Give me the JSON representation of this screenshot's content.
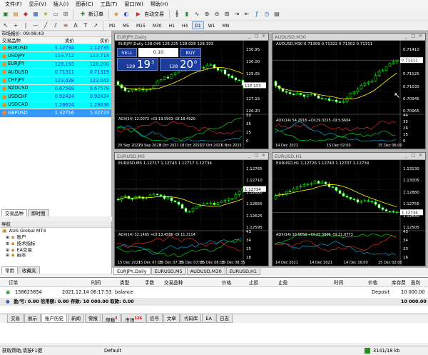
{
  "menu": [
    "文件(F)",
    "显示(V)",
    "插入(I)",
    "图表(C)",
    "工具(T)",
    "窗口(W)",
    "帮助(H)"
  ],
  "toolbar": {
    "new_order": "新订单",
    "auto_trading": "自动交易",
    "timeframes": [
      "M1",
      "M5",
      "M15",
      "M30",
      "H1",
      "H4",
      "D1",
      "W1",
      "MN"
    ],
    "active_timeframe": "D1"
  },
  "market_watch": {
    "title": "市场报价: 09:08:43",
    "headers": {
      "symbol": "交易品种",
      "bid": "卖价",
      "ask": "买价"
    },
    "rows": [
      {
        "symbol": "EURUSD",
        "bid": "1.12734",
        "ask": "1.12735"
      },
      {
        "symbol": "USDJPY",
        "bid": "113.712",
        "ask": "113.714"
      },
      {
        "symbol": "EURJPY",
        "bid": "128.193",
        "ask": "128.200"
      },
      {
        "symbol": "AUDUSD",
        "bid": "0.71311",
        "ask": "0.71319"
      },
      {
        "symbol": "CHFJPY",
        "bid": "123.028",
        "ask": "123.042"
      },
      {
        "symbol": "NZDUSD",
        "bid": "0.67569",
        "ask": "0.67578"
      },
      {
        "symbol": "USDCHF",
        "bid": "0.92424",
        "ask": "0.92434"
      },
      {
        "symbol": "USDCAD",
        "bid": "1.28624",
        "ask": "1.28636"
      },
      {
        "symbol": "GBPUSD",
        "bid": "1.32716",
        "ask": "1.32723"
      }
    ],
    "tabs": [
      "交易品种",
      "即时图"
    ]
  },
  "navigator": {
    "title": "导航",
    "items": [
      "AUS Global MT4",
      "账户",
      "技术指标",
      "EA交易",
      "脚本"
    ],
    "tabs": [
      "常用",
      "收藏夹"
    ]
  },
  "charts": [
    {
      "title": "EURJPY,Daily",
      "info": "EURJPY,Daily  128.046 128.225 128.028 128.193",
      "indicator": "ADX(14) 22.0072 +DI:19.5903 -DI:18.4920",
      "sell_label": "SELL",
      "buy_label": "BUY",
      "lot": "0.10",
      "sell_small": "128",
      "sell_big": "19",
      "sell_sup": "3",
      "buy_small": "128",
      "buy_big": "20",
      "buy_sup": "0",
      "price_tag": "128.193",
      "y_labels": [
        "130.95",
        "130.00",
        "129.05",
        "128.10",
        "127.15",
        "126.20",
        "50",
        "35",
        "25",
        "0"
      ],
      "x_labels": [
        "20 Sep 2021",
        "29 Sep 2021",
        "8 Oct 2021",
        "18 Oct 2021",
        "27 Oct 2021",
        "5 Nov 2021"
      ]
    },
    {
      "title": "AUDUSD,M30",
      "info": "AUDUSD,M30  0.71309 0.71322 0.71302 0.71311",
      "indicator": "ADX(14) 54.2918 +DI:29.3225 -DI:5.6604",
      "price_tag": "0.71311",
      "y_labels": [
        "0.71410",
        "0.71220",
        "0.71125",
        "0.71030",
        "0.70945",
        "0.70965",
        "44",
        "35",
        "26",
        "15",
        "0"
      ],
      "x_labels": [
        "14 Dec 2021",
        "15 Dec 02:00",
        "15 Dec 06:00"
      ]
    },
    {
      "title": "EURUSD,M5",
      "info": "EURUSD,M5  1.12717 1.12743 1.12717 1.12734",
      "indicator": "ADX(14) 32.1485 +DI:13.4586 -DI:11.3114",
      "price_tag": "1.12734",
      "y_labels": [
        "1.12765",
        "1.12710",
        "1.12680",
        "1.12655",
        "1.12625",
        "1.12595",
        "43",
        "34",
        "25",
        "18"
      ],
      "x_labels": [
        "15 Dec 2021",
        "15 Dec 07:15",
        "15 Dec 07:35",
        "15 Dec 07:55",
        "15 Dec 08:15",
        "15 Dec 08:35"
      ]
    },
    {
      "title": "EURUSD,H1",
      "info": "EURUSD,H1  1.12726 1.12743 1.12707 1.12734",
      "indicator": "ADX(14) 18.5658 +DI:25.3806 -DI:21.0773",
      "price_tag": "1.12734",
      "y_labels": [
        "1.13130",
        "1.13005",
        "1.12880",
        "1.12755",
        "1.12630",
        "1.12505",
        "43",
        "34",
        "23",
        "16"
      ],
      "x_labels": [
        "14 Dec 2021",
        "14 Dec 2021",
        "14 Dec 16:00",
        "15 Dec 02:00"
      ]
    }
  ],
  "chart_tabs": [
    "EURJPY,Daily",
    "EURUSD,M5",
    "AUDUSD,M30",
    "EURUSD,H1"
  ],
  "terminal": {
    "headers": {
      "order": "订单",
      "time": "时间",
      "type": "类型",
      "size": "手数",
      "symbol": "交易品种",
      "price": "价格",
      "sl": "止损",
      "tp": "止盈",
      "close_time": "时间",
      "close_price": "价格",
      "swap": "库存费",
      "profit": "盈利"
    },
    "row": {
      "order": "158625854",
      "time": "2021.12.14 06:17:53",
      "type": "balance",
      "swap": "Deposit",
      "profit": "10 000.00"
    },
    "summary": "盈/亏: 0.00  信用额: 0.00  存款: 10 000.00  取款: 0.00",
    "summary_profit": "10 000.00",
    "tabs": [
      {
        "label": "交易"
      },
      {
        "label": "展示"
      },
      {
        "label": "账户历史"
      },
      {
        "label": "新闻"
      },
      {
        "label": "警报"
      },
      {
        "label": "邮箱",
        "badge": "2"
      },
      {
        "label": "市场",
        "badge": "126"
      },
      {
        "label": "信号"
      },
      {
        "label": "文章"
      },
      {
        "label": "代码库"
      },
      {
        "label": "EA"
      },
      {
        "label": "日志"
      }
    ],
    "active_tab": "账户历史"
  },
  "status": {
    "help": "获取帮助,请按F1键",
    "profile": "Default",
    "traffic": "3141/18 kb"
  },
  "colors": {
    "quote_row": "#00ffff",
    "selected_row": "#3399ff",
    "chart_bg": "#000000",
    "bull": "#00ff00",
    "ma": "#ffff00",
    "buy": "#1e3c9c"
  }
}
